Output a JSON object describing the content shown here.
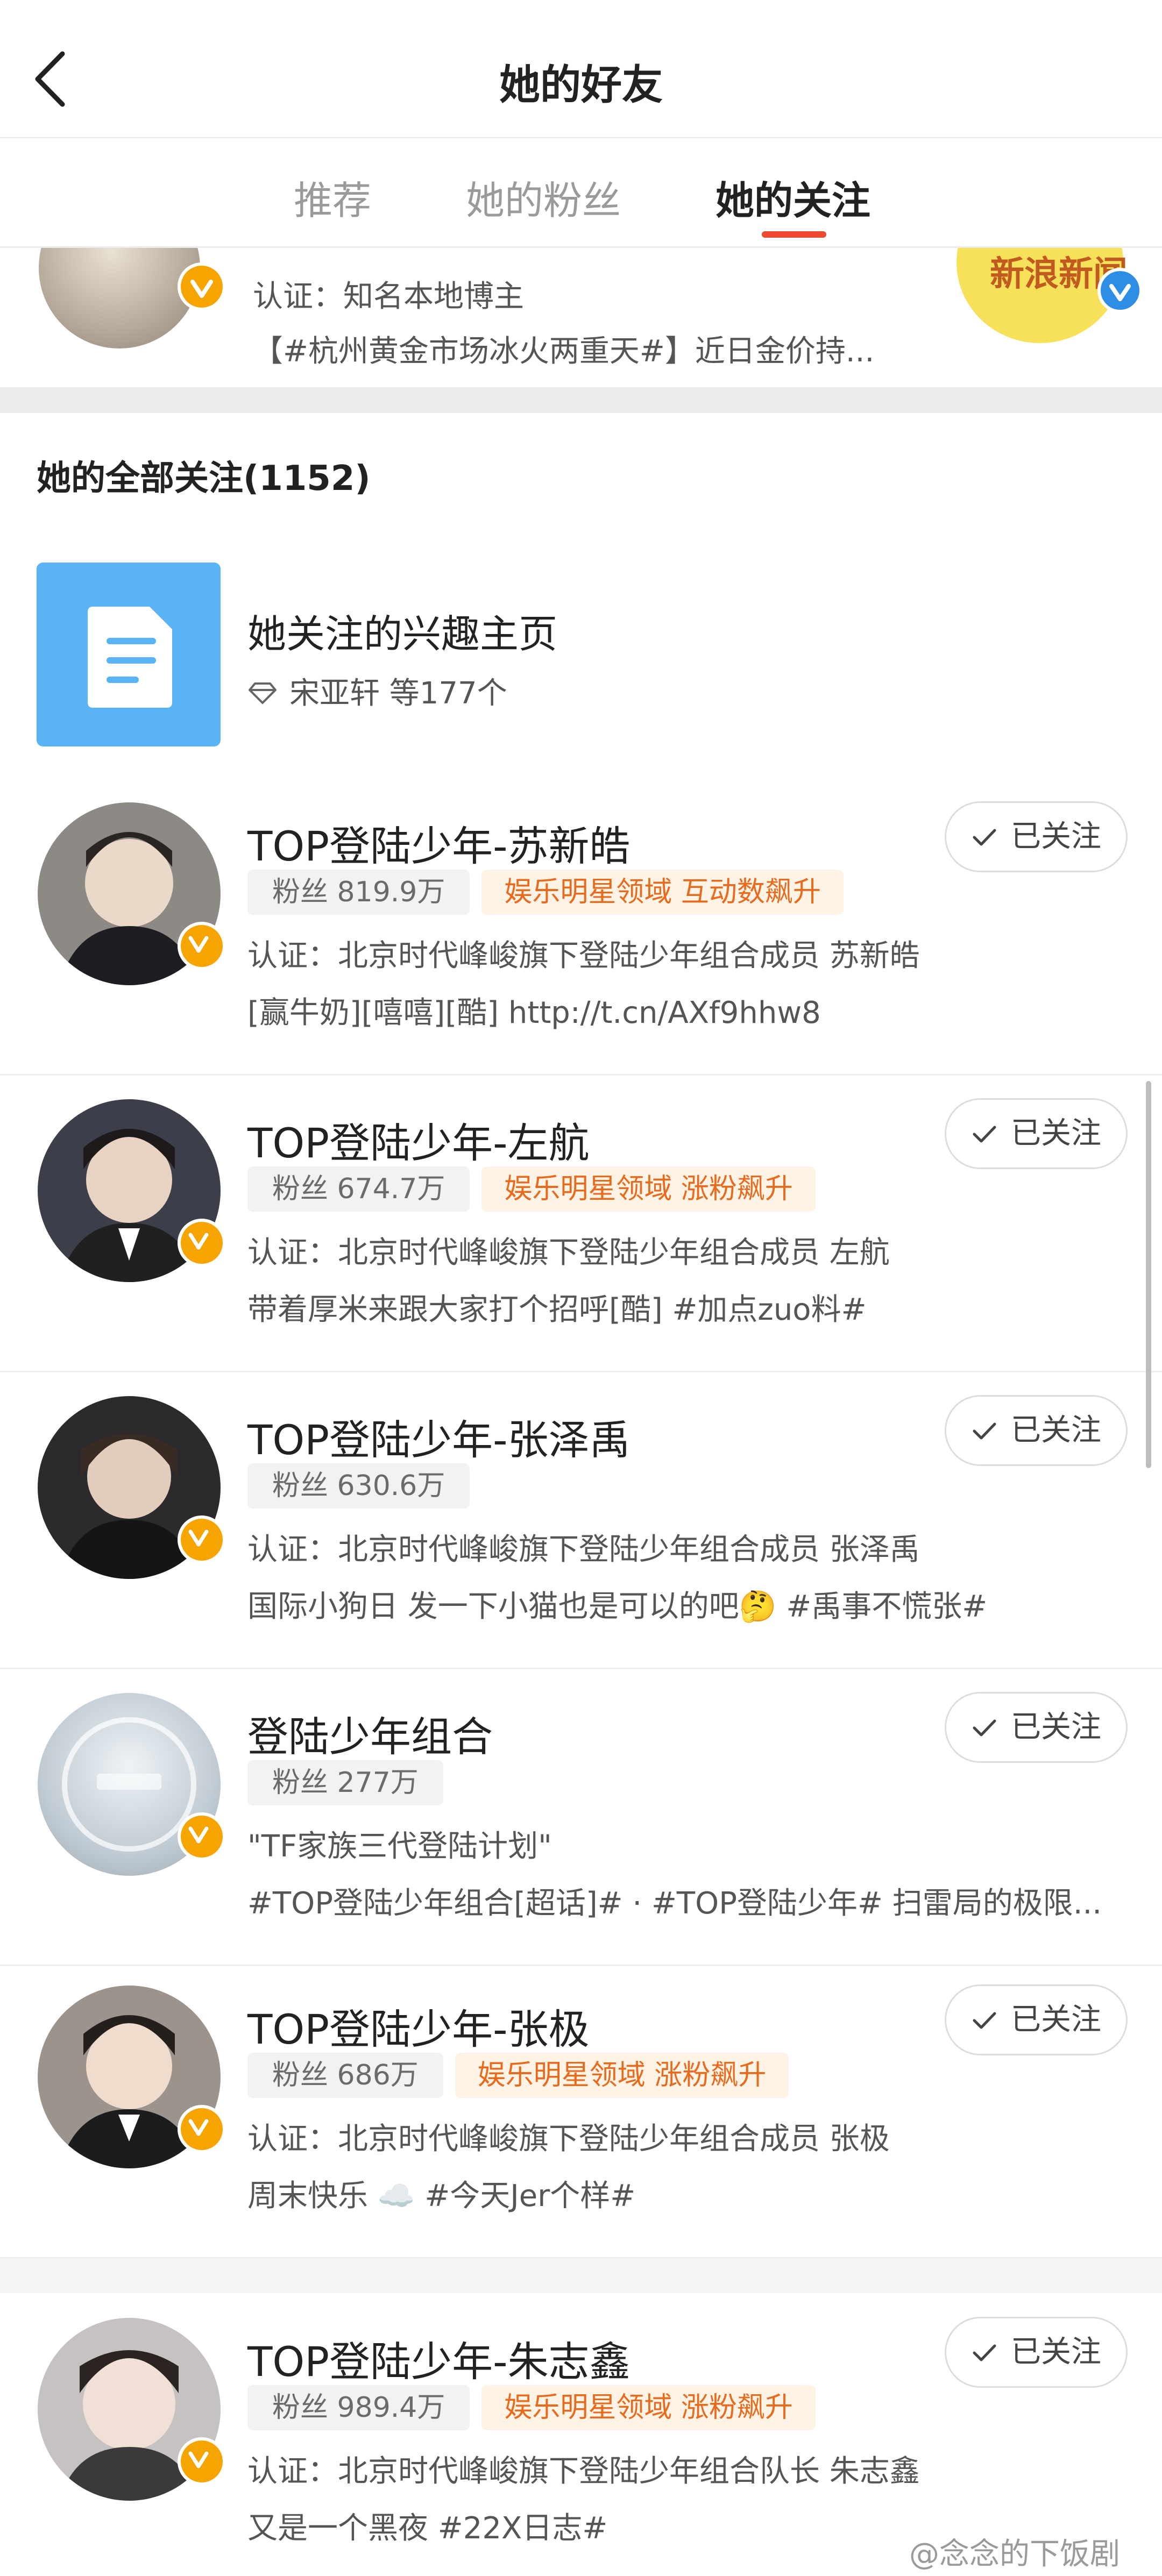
{
  "header": {
    "title": "她的好友",
    "tabs": [
      {
        "label": "推荐"
      },
      {
        "label": "她的粉丝"
      },
      {
        "label": "她的关注"
      }
    ],
    "active_tab": "她的关注"
  },
  "top_card": {
    "line1": "认证：知名本地博主",
    "line2": "【#杭州黄金市场冰火两重天#】近日金价持...",
    "avatar_fragment": "新浪新闻"
  },
  "section_title": "她的全部关注(1152)",
  "interest": {
    "title": "她关注的兴趣主页",
    "subtitle": "宋亚轩 等177个"
  },
  "users": [
    {
      "name": "TOP登陆少年-苏新皓",
      "fans": "粉丝 819.9万",
      "tag": "娱乐明星领域 互动数飙升",
      "line1": "认证：北京时代峰峻旗下登陆少年组合成员 苏新皓",
      "line2": "[赢牛奶][嘻嘻][酷] http://t.cn/AXf9hhw8",
      "follow": "已关注",
      "avatar_color": "#8d8a86"
    },
    {
      "name": "TOP登陆少年-左航",
      "fans": "粉丝 674.7万",
      "tag": "娱乐明星领域 涨粉飙升",
      "line1": "认证：北京时代峰峻旗下登陆少年组合成员 左航",
      "line2": "带着厚米来跟大家打个招呼[酷] #加点zuo料#",
      "follow": "已关注",
      "avatar_color": "#3c3f49"
    },
    {
      "name": "TOP登陆少年-张泽禹",
      "fans": "粉丝 630.6万",
      "tag": "",
      "line1": "认证：北京时代峰峻旗下登陆少年组合成员 张泽禹",
      "line2": "国际小狗日 发一下小猫也是可以的吧🤔 #禹事不慌张#",
      "follow": "已关注",
      "avatar_color": "#2c2a2c"
    },
    {
      "name": "登陆少年组合",
      "fans": "粉丝 277万",
      "tag": "",
      "line1": "\"TF家族三代登陆计划\"",
      "line2": "#TOP登陆少年组合[超话]# · #TOP登陆少年# 扫雷局的极限...",
      "follow": "已关注",
      "avatar_color": "#cfd8e0"
    },
    {
      "name": "TOP登陆少年-张极",
      "fans": "粉丝 686万",
      "tag": "娱乐明星领域 涨粉飙升",
      "line1": "认证：北京时代峰峻旗下登陆少年组合成员 张极",
      "line2": "周末快乐 ☁️ #今天Jer个样#",
      "follow": "已关注",
      "avatar_color": "#9b938c"
    },
    {
      "name": "TOP登陆少年-朱志鑫",
      "fans": "粉丝 989.4万",
      "tag": "娱乐明星领域 涨粉飙升",
      "line1": "认证：北京时代峰峻旗下登陆少年组合队长 朱志鑫",
      "line2": "又是一个黑夜 #22X日志#",
      "follow": "已关注",
      "avatar_color": "#c7c2c2"
    }
  ],
  "watermark": "@念念的下饭剧",
  "colors": {
    "accent": "#ef4a30",
    "verified": "#f6a400",
    "hot_tag": "#e76a1d"
  }
}
